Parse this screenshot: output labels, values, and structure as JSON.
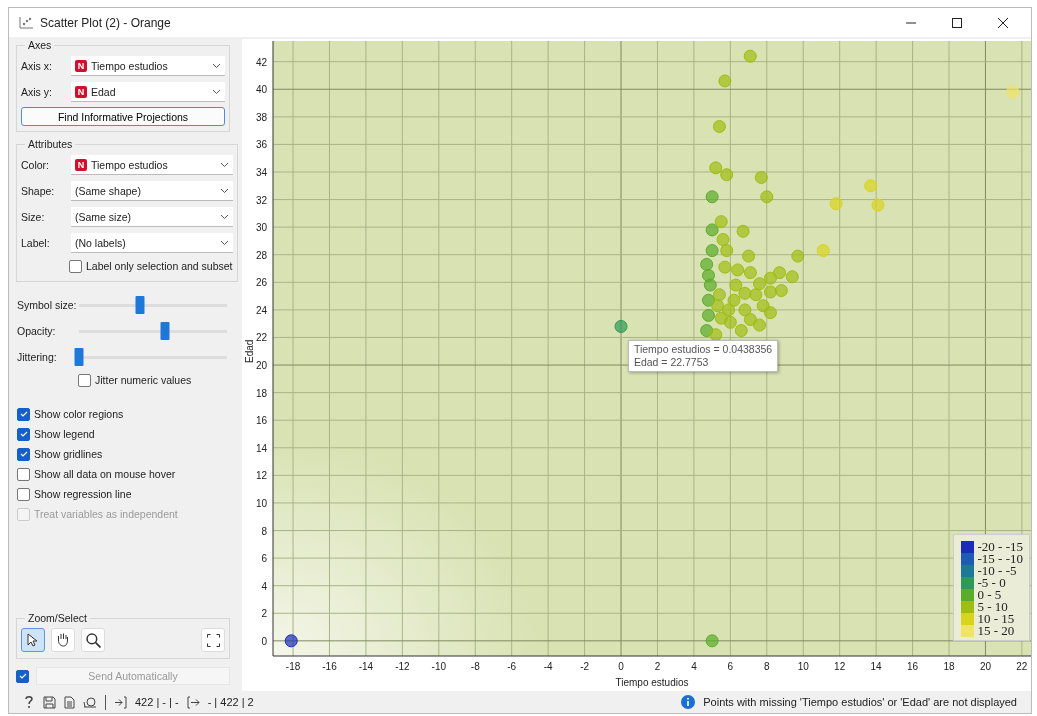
{
  "window": {
    "title": "Scatter Plot (2) - Orange"
  },
  "axes": {
    "title": "Axes",
    "fields": [
      {
        "label": "Axis x:",
        "badge": "N",
        "value": "Tiempo estudios"
      },
      {
        "label": "Axis y:",
        "badge": "N",
        "value": "Edad"
      }
    ],
    "button": "Find Informative Projections"
  },
  "attributes": {
    "title": "Attributes",
    "fields": [
      {
        "label": "Color:",
        "badge": "N",
        "value": "Tiempo estudios"
      },
      {
        "label": "Shape:",
        "value": "(Same shape)"
      },
      {
        "label": "Size:",
        "value": "(Same size)"
      },
      {
        "label": "Label:",
        "value": "(No labels)"
      }
    ],
    "checkbox": {
      "label": "Label only selection and subset",
      "checked": false
    }
  },
  "sliders": [
    {
      "label": "Symbol size:",
      "level": 0.41
    },
    {
      "label": "Opacity:",
      "level": 0.58
    },
    {
      "label": "Jittering:",
      "level": 0.0
    }
  ],
  "jitter_checkbox": {
    "label": "Jitter numeric values",
    "checked": false
  },
  "options": [
    {
      "label": "Show color regions",
      "checked": true,
      "disabled": false
    },
    {
      "label": "Show legend",
      "checked": true,
      "disabled": false
    },
    {
      "label": "Show gridlines",
      "checked": true,
      "disabled": false
    },
    {
      "label": "Show all data on mouse hover",
      "checked": false,
      "disabled": false
    },
    {
      "label": "Show regression line",
      "checked": false,
      "disabled": false
    },
    {
      "label": "Treat variables as independent",
      "checked": false,
      "disabled": true
    }
  ],
  "zoom_select": {
    "title": "Zoom/Select",
    "tools": [
      {
        "kind": "select",
        "selected": true
      },
      {
        "kind": "pan",
        "selected": false
      },
      {
        "kind": "zoom",
        "selected": false
      },
      {
        "kind": "reset",
        "selected": false
      }
    ]
  },
  "send": {
    "checked": true,
    "label": "Send Automatically",
    "disabled": true
  },
  "plot": {
    "tooltip": [
      "Tiempo estudios = 0.0438356",
      "Edad = 22.7753"
    ],
    "chart_data": {
      "type": "scatter",
      "grid": true,
      "xlabel": "Tiempo estudios",
      "ylabel": "Edad",
      "xlim": [
        -19.1,
        22.5
      ],
      "ylim": [
        -1.1,
        43.5
      ],
      "xticks": [
        -18,
        -16,
        -14,
        -12,
        -10,
        -8,
        -6,
        -4,
        -2,
        0,
        2,
        4,
        6,
        8,
        10,
        12,
        14,
        16,
        18,
        20,
        22
      ],
      "yticks": [
        0,
        2,
        4,
        6,
        8,
        10,
        12,
        14,
        16,
        18,
        20,
        22,
        24,
        26,
        28,
        30,
        32,
        34,
        36,
        38,
        40,
        42
      ],
      "series": [
        {
          "name": "-20 - -15",
          "color": "#1a2db8",
          "x": [
            -18.1
          ],
          "values": [
            0
          ]
        },
        {
          "name": "-15 - -10",
          "color": "#1d5cb2"
        },
        {
          "name": "-10 - -5",
          "color": "#1f7896"
        },
        {
          "name": "-5 - 0",
          "color": "#2f9a58",
          "x": [
            0.0
          ],
          "values": [
            22.8
          ]
        },
        {
          "name": "0 - 5",
          "color": "#5aad2a",
          "x": [
            5.0,
            5.0,
            4.7,
            4.8,
            4.9,
            4.8,
            4.8,
            4.7,
            5.0,
            5.0
          ],
          "values": [
            0,
            32.2,
            27.3,
            26.5,
            25.8,
            24.7,
            23.6,
            22.5,
            28.3,
            29.8
          ]
        },
        {
          "name": "5 - 10",
          "color": "#9fbd12",
          "x": [
            7.09,
            5.7,
            5.4,
            5.2,
            5.8,
            7.7,
            8.0,
            6.7,
            7.0,
            9.4,
            8.7,
            8.2,
            7.6,
            5.5,
            5.6,
            5.8,
            5.7,
            6.4,
            7.1,
            5.4,
            5.5,
            6.2,
            6.8,
            7.4,
            7.8,
            8.2,
            8.8,
            7.1,
            7.6,
            6.0,
            6.6,
            5.2,
            6.3,
            6.8,
            8.2,
            5.8,
            5.3,
            5.9,
            9.7
          ],
          "values": [
            42.4,
            40.6,
            37.3,
            34.3,
            33.8,
            33.6,
            32.2,
            29.7,
            27.9,
            26.4,
            26.7,
            26.3,
            25.9,
            30.4,
            29.1,
            28.3,
            27.1,
            26.9,
            26.7,
            25.1,
            23.4,
            24.7,
            24.0,
            25.1,
            24.3,
            25.3,
            25.4,
            23.3,
            22.9,
            23.1,
            22.5,
            22.2,
            25.8,
            25.2,
            23.8,
            null,
            24.3,
            24.0,
            27.9
          ]
        },
        {
          "name": "10 - 15",
          "color": "#d8d41e",
          "x": [
            13.7,
            11.8,
            14.1,
            11.1
          ],
          "values": [
            33.0,
            31.7,
            31.6,
            28.3
          ]
        },
        {
          "name": "15 - 20",
          "color": "#f0e468",
          "x": [
            21.5
          ],
          "values": [
            39.8
          ]
        }
      ]
    }
  },
  "status": {
    "input": "422 | - | -",
    "output": "- | 422 | 2",
    "message": "Points with missing 'Tiempo estudios' or 'Edad' are not displayed"
  }
}
